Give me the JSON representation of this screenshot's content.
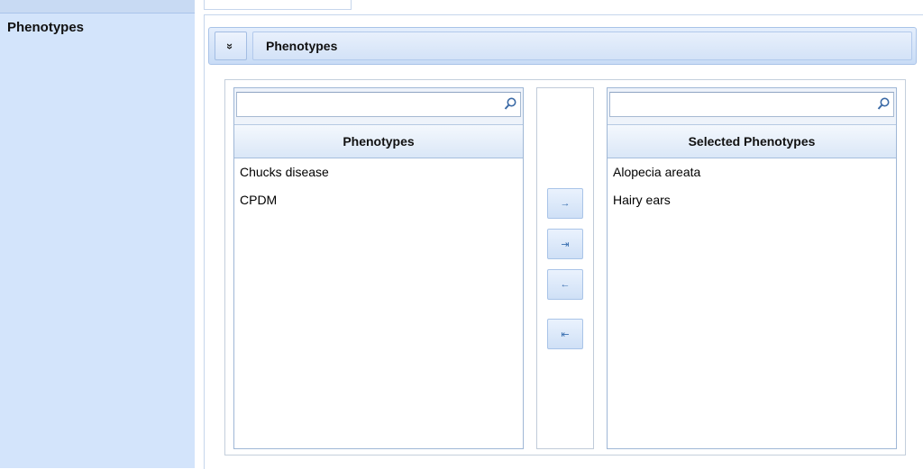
{
  "field": {
    "label": "Phenotypes"
  },
  "panel": {
    "title": "Phenotypes",
    "collapse_icon": "double-chevron-down-icon",
    "collapse_glyph": "»"
  },
  "available": {
    "search_value": "",
    "search_placeholder": "",
    "header": "Phenotypes",
    "items": [
      "Chucks disease",
      "CPDM"
    ]
  },
  "selected": {
    "search_value": "",
    "search_placeholder": "",
    "header": "Selected Phenotypes",
    "items": [
      "Alopecia areata",
      "Hairy ears"
    ]
  },
  "buttons": {
    "move_right": {
      "glyph": "→",
      "icon": "arrow-right-icon"
    },
    "move_all_right": {
      "glyph": "⇥",
      "icon": "arrow-right-bar-icon"
    },
    "move_left": {
      "glyph": "←",
      "icon": "arrow-left-icon"
    },
    "move_all_left": {
      "glyph": "⇤",
      "icon": "bar-arrow-left-icon"
    }
  },
  "colors": {
    "label_column_bg": "#d3e4fb",
    "header_gradient_top": "#e4eefc",
    "header_gradient_bottom": "#c9dcf6",
    "button_arrow": "#3a6fb0"
  }
}
